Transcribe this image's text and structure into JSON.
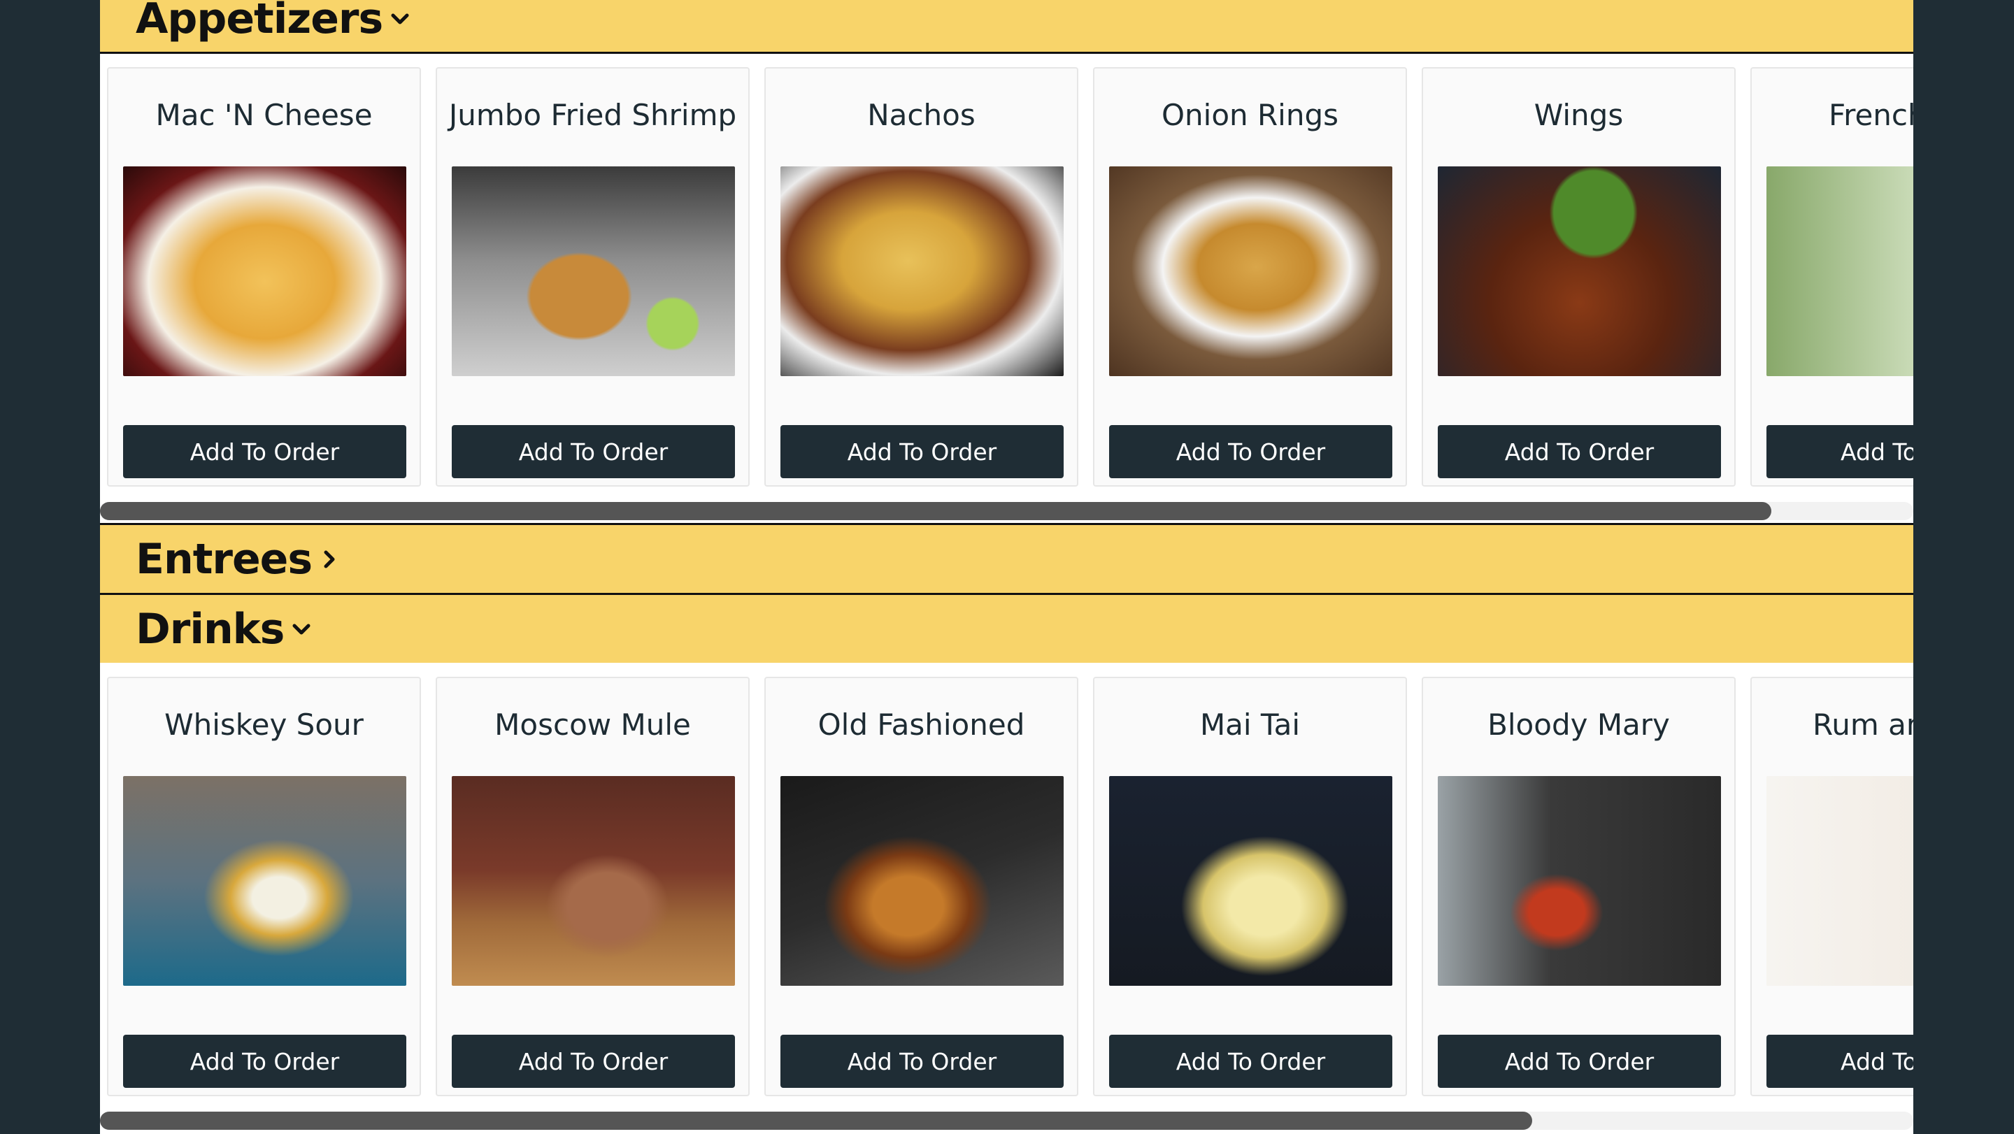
{
  "sections": [
    {
      "title": "Appetizers",
      "expanded": true,
      "items": [
        {
          "name": "Mac 'N Cheese",
          "button": "Add To Order",
          "image": "mac-n-cheese-photo"
        },
        {
          "name": "Jumbo Fried Shrimp",
          "button": "Add To Order",
          "image": "fried-shrimp-photo"
        },
        {
          "name": "Nachos",
          "button": "Add To Order",
          "image": "nachos-photo"
        },
        {
          "name": "Onion Rings",
          "button": "Add To Order",
          "image": "onion-rings-photo"
        },
        {
          "name": "Wings",
          "button": "Add To Order",
          "image": "wings-photo"
        },
        {
          "name": "French",
          "button": "Add To",
          "image": "french-fries-photo"
        }
      ],
      "scroll_position_fraction": 0.92
    },
    {
      "title": "Entrees",
      "expanded": false,
      "items": []
    },
    {
      "title": "Drinks",
      "expanded": true,
      "items": [
        {
          "name": "Whiskey Sour",
          "button": "Add To Order",
          "image": "whiskey-sour-photo"
        },
        {
          "name": "Moscow Mule",
          "button": "Add To Order",
          "image": "moscow-mule-photo"
        },
        {
          "name": "Old Fashioned",
          "button": "Add To Order",
          "image": "old-fashioned-photo"
        },
        {
          "name": "Mai Tai",
          "button": "Add To Order",
          "image": "mai-tai-photo"
        },
        {
          "name": "Bloody Mary",
          "button": "Add To Order",
          "image": "bloody-mary-photo"
        },
        {
          "name": "Rum an",
          "button": "Add To",
          "image": "rum-and-coke-photo"
        }
      ],
      "scroll_position_fraction": 0.79
    }
  ],
  "colors": {
    "page_background": "#1f2d35",
    "section_header": "#f8d46a",
    "button": "#1f2d35",
    "button_text": "#ffffff",
    "scrollbar_thumb": "#555555"
  },
  "icons": {
    "expanded": "chevron-down-icon",
    "collapsed": "chevron-right-icon"
  }
}
